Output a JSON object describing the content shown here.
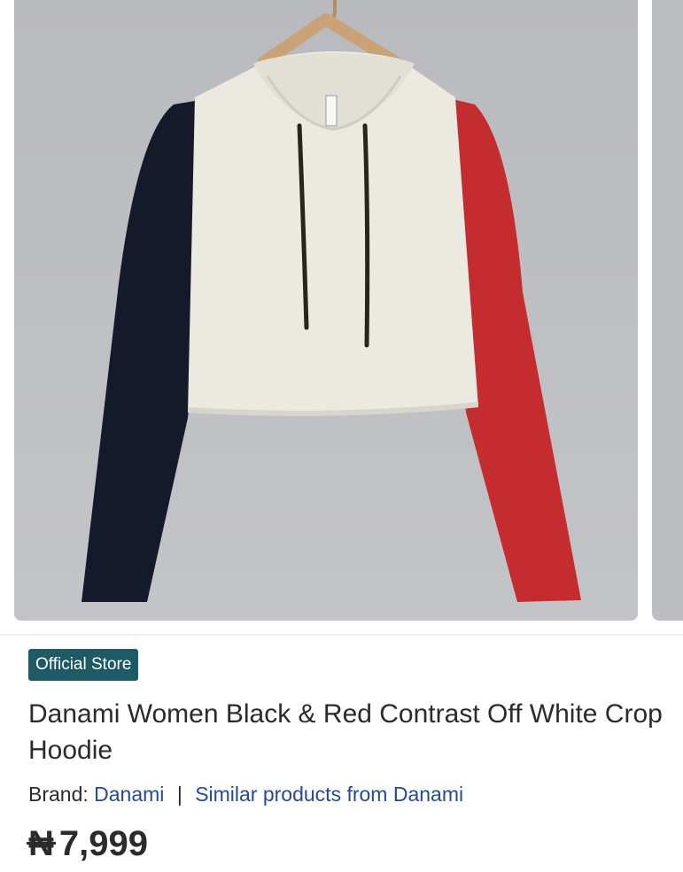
{
  "gallery": {
    "image_alt": "Danami Women Black & Red Contrast Off White Crop Hoodie product image"
  },
  "product": {
    "badge": "Official Store",
    "title": "Danami Women Black & Red Contrast Off White Crop Hoodie",
    "brand_label": "Brand:",
    "brand_name": "Danami",
    "separator": "|",
    "similar_link": "Similar products from Danami",
    "currency_symbol": "₦",
    "price": "7,999"
  },
  "colors": {
    "badge_bg": "#1e5966",
    "link": "#264996",
    "text": "#2b2b2b",
    "image_bg": "#bdbec2"
  }
}
